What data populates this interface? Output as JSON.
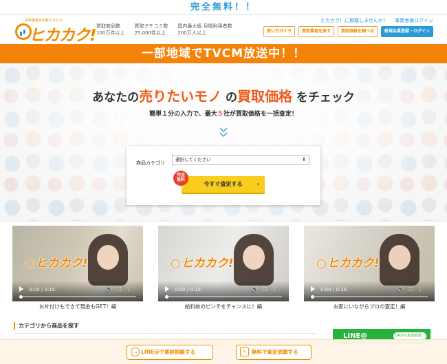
{
  "topbar": {
    "text": "完全無料！！"
  },
  "logo": {
    "tagline": "買取価格を比較するなら",
    "text": "ヒカカク!"
  },
  "stats": [
    {
      "label": "買取商品数",
      "value": "100万件以上"
    },
    {
      "label": "買取クチコミ数",
      "value": "25,000件以上"
    },
    {
      "label": "国内最大級 月間利用者数",
      "value": "200万人以上"
    }
  ],
  "header_links": {
    "partner": "ヒカカク！に掲載しませんか？",
    "shop_login": "事業者様ログイン"
  },
  "header_buttons": {
    "guide": "使い方ガイド",
    "find_shop": "買取業者を探す",
    "check_price": "買取価格を調べる",
    "register": "新規会員登録・ログイン"
  },
  "banner": {
    "text": "一部地域でTVCM放送中！！"
  },
  "hero": {
    "title_pre": "あなたの",
    "title_hl1": "売りたいモノ",
    "title_mid": " の",
    "title_hl2": "買取価格",
    "title_post": " をチェック",
    "sub_pre": "簡単１分の入力で、最大",
    "sub_num": "５",
    "sub_post": "社が買取価格を一括査定！"
  },
  "search": {
    "category_label": "商品カテゴリ",
    "category_value": "選択してください",
    "free_badge_1": "完全",
    "free_badge_2": "無料",
    "submit": "今すぐ査定する",
    "submit_arrow": "›"
  },
  "videos": [
    {
      "logo": "ヒカカク!",
      "time": "0:00 / 0:15",
      "caption": "お片付けもできて現金もGET！編"
    },
    {
      "logo": "ヒカカク!",
      "time": "0:00 / 0:15",
      "caption": "給料前のピンチをチャンスに！編"
    },
    {
      "logo": "ヒカカク!",
      "time": "0:00 / 0:15",
      "caption": "お家にいながらプロの査定！編"
    }
  ],
  "category_section": {
    "heading": "カテゴリから商品を探す"
  },
  "line_banner": {
    "text": "LINE@",
    "qr": "QRから友達追加！"
  },
  "bottom_bar": {
    "line_consult": "LINE@で事前相談する",
    "free_request": "無料で査定依頼する"
  }
}
